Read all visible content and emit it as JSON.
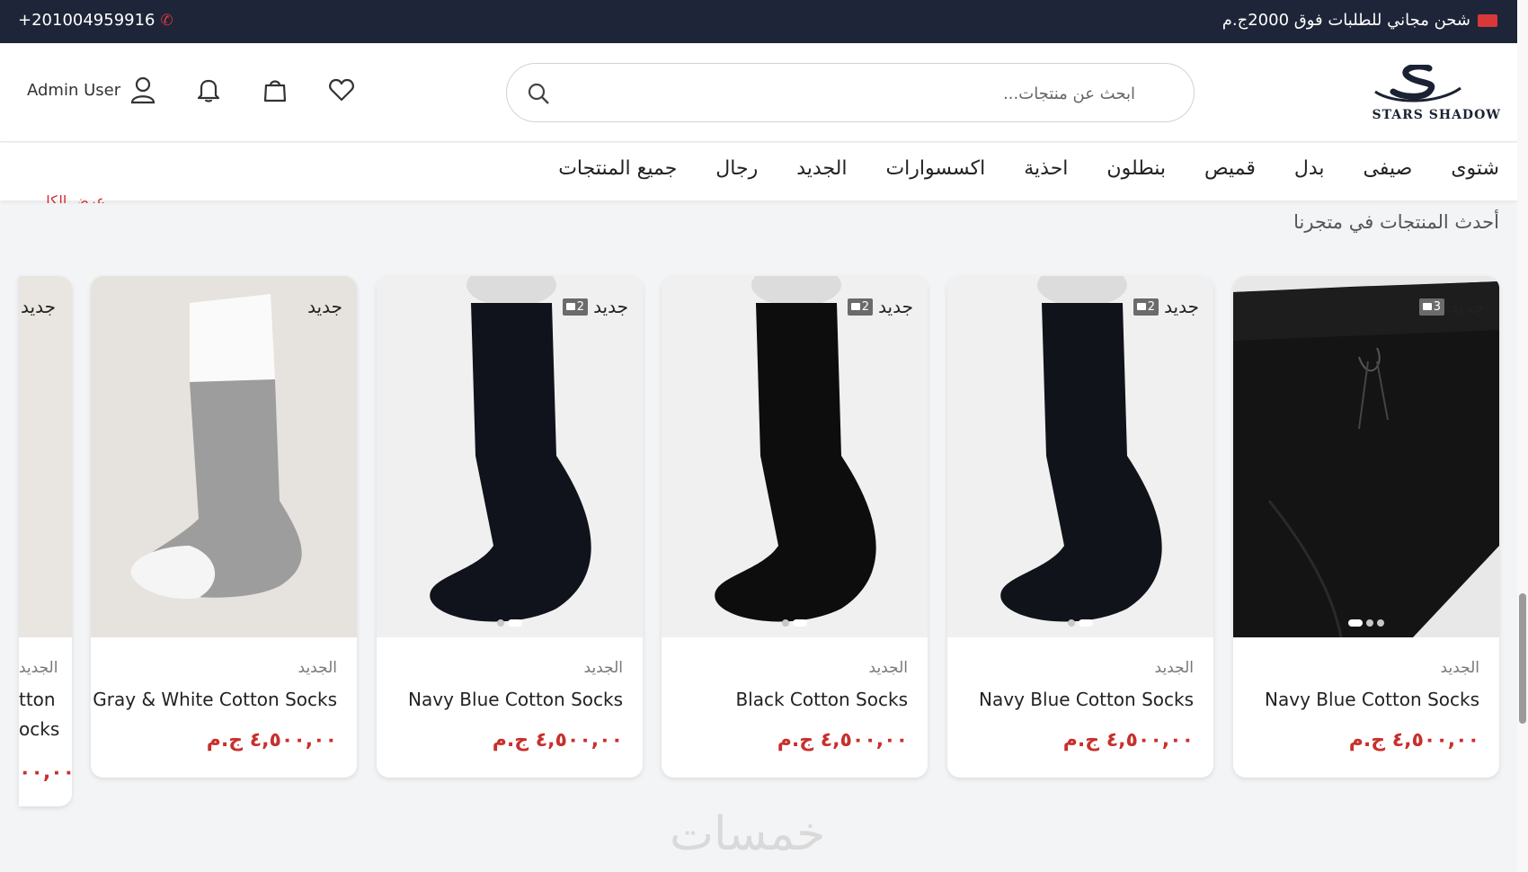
{
  "topbar": {
    "phone": "+201004959916",
    "shipping_notice": "شحن مجاني للطلبات فوق 2000ج.م"
  },
  "header": {
    "logo_text": "STARS SHADOW",
    "search_placeholder": "ابحث عن منتجات...",
    "user_name": "Admin User"
  },
  "nav": {
    "items": [
      "شتوى",
      "صيفى",
      "بدل",
      "قميص",
      "بنطلون",
      "احذية",
      "اكسسوارات",
      "الجديد",
      "رجال",
      "جميع المنتجات"
    ]
  },
  "section": {
    "title": "أحدث المنتجات في متجرنا",
    "view_all": "عرض الكل"
  },
  "products": [
    {
      "badge": "جديد",
      "image_count": "3",
      "category": "الجديد",
      "name": "Navy Blue Cotton Socks",
      "price": "٤,٥٠٠,٠٠ ج.م"
    },
    {
      "badge": "جديد",
      "image_count": "2",
      "category": "الجديد",
      "name": "Navy Blue Cotton Socks",
      "price": "٤,٥٠٠,٠٠ ج.م"
    },
    {
      "badge": "جديد",
      "image_count": "2",
      "category": "الجديد",
      "name": "Black Cotton Socks",
      "price": "٤,٥٠٠,٠٠ ج.م"
    },
    {
      "badge": "جديد",
      "image_count": "2",
      "category": "الجديد",
      "name": "Navy Blue Cotton Socks",
      "price": "٤,٥٠٠,٠٠ ج.م"
    },
    {
      "badge": "جديد",
      "image_count": "",
      "category": "الجديد",
      "name": "Gray & White Cotton Socks",
      "price": "٤,٥٠٠,٠٠ ج.م"
    }
  ],
  "partial_card": {
    "badge": "جديد",
    "category": "الجديد",
    "name_line1": "tton",
    "name_line2": "ocks",
    "price": "٠٠,٠٠"
  },
  "watermark": "خمسات",
  "colors": {
    "topbar_bg": "#1e2538",
    "accent_red": "#c8302c"
  }
}
